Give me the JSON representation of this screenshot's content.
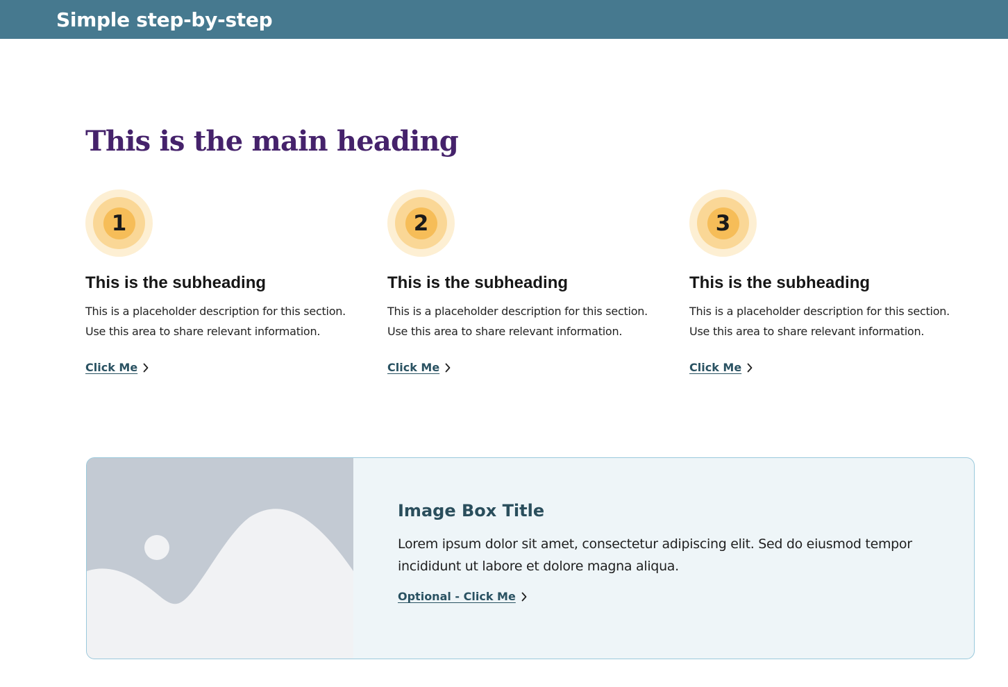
{
  "header": {
    "title": "Simple step-by-step"
  },
  "main": {
    "heading": "This is the main heading"
  },
  "steps": [
    {
      "number": "1",
      "subheading": "This is the subheading",
      "description_line1": "This is a placeholder description for this section.",
      "description_line2": "Use this area to share relevant information.",
      "link_label": "Click Me"
    },
    {
      "number": "2",
      "subheading": "This is the subheading",
      "description_line1": "This is a placeholder description for this section.",
      "description_line2": "Use this area to share relevant information.",
      "link_label": "Click Me"
    },
    {
      "number": "3",
      "subheading": "This is the subheading",
      "description_line1": "This is a placeholder description for this section.",
      "description_line2": "Use this area to share relevant information.",
      "link_label": "Click Me"
    }
  ],
  "image_box": {
    "title": "Image Box Title",
    "text_line1": "Lorem ipsum dolor sit amet, consectetur adipiscing elit. Sed do eiusmod tempor",
    "text_line2": "incididunt ut labore et dolore magna aliqua.",
    "link_label": "Optional - Click Me",
    "image_icon": "image-placeholder-icon"
  },
  "icons": {
    "link_chevron": "chevron-right-icon"
  },
  "colors": {
    "header_bg": "#46798f",
    "heading": "#45226b",
    "link": "#2a5262",
    "badge_outer": "#fdefd3",
    "badge_mid": "#fad796",
    "badge_inner": "#f6bd58",
    "imagebox_bg": "#eef5f8",
    "imagebox_border": "#9ac9dc"
  }
}
